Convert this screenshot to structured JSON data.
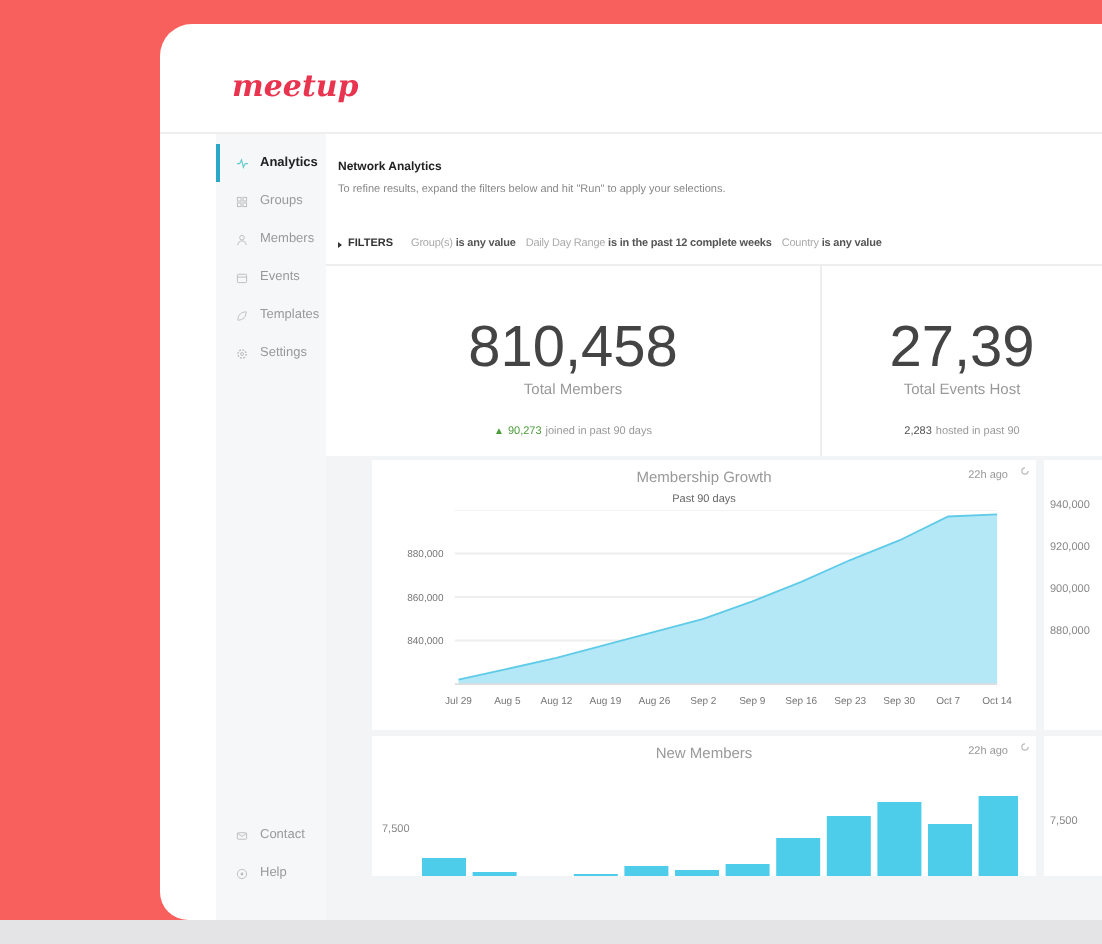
{
  "logo": "meetup",
  "sidebar": {
    "items": [
      {
        "label": "Analytics",
        "kind": "analytics",
        "selected": true
      },
      {
        "label": "Groups",
        "kind": "groups",
        "selected": false
      },
      {
        "label": "Members",
        "kind": "members",
        "selected": false
      },
      {
        "label": "Events",
        "kind": "events",
        "selected": false
      },
      {
        "label": "Templates",
        "kind": "templates",
        "selected": false
      },
      {
        "label": "Settings",
        "kind": "settings",
        "selected": false
      }
    ],
    "footer_items": [
      {
        "label": "Contact",
        "kind": "contact"
      },
      {
        "label": "Help",
        "kind": "help"
      }
    ]
  },
  "header": {
    "title": "Network Analytics",
    "subtitle": "To refine results, expand the filters below and hit \"Run\" to apply your selections."
  },
  "filters": {
    "label": "FILTERS",
    "items": [
      "Group(s) **is any value**",
      "Daily Day Range **is in the past 12 complete weeks**",
      "Country **is any value**"
    ]
  },
  "stats": [
    {
      "value": "810,458",
      "label": "Total Members",
      "trend_icon": "▲",
      "change": "90,273",
      "note": "joined in past 90 days"
    },
    {
      "value": "27,39",
      "label": "Total Events Host",
      "change": "2,283",
      "note": "hosted in past 90"
    }
  ],
  "charts": [
    {
      "title": "Membership Growth",
      "subtitle": "Past 90 days",
      "updated": "22h ago",
      "chart_data": {
        "type": "area",
        "categories": [
          "Jul 29",
          "Aug 5",
          "Aug 12",
          "Aug 19",
          "Aug 26",
          "Sep 2",
          "Sep 9",
          "Sep 16",
          "Sep 23",
          "Sep 30",
          "Oct 7",
          "Oct 14"
        ],
        "grid": true,
        "ylim": [
          820000,
          900000
        ],
        "series": [
          {
            "color": "#b5e8f6",
            "values": [
              822000,
              827000,
              832000,
              838000,
              844000,
              850000,
              858000,
              867000,
              877000,
              886000,
              897000,
              898000
            ]
          }
        ],
        "yticks": [
          {
            "value": 840000,
            "label": "840,000"
          },
          {
            "value": 860000,
            "label": "860,000"
          },
          {
            "value": 880000,
            "label": "880,000"
          }
        ]
      }
    },
    {
      "title": "New Members",
      "updated": "22h ago",
      "axis_labels": [
        "7,500"
      ]
    }
  ],
  "side_charts": [
    {
      "axis_labels": [
        "940,000",
        "920,000",
        "900,000",
        "880,000"
      ]
    },
    {
      "axis_labels": [
        "7,500"
      ]
    }
  ]
}
